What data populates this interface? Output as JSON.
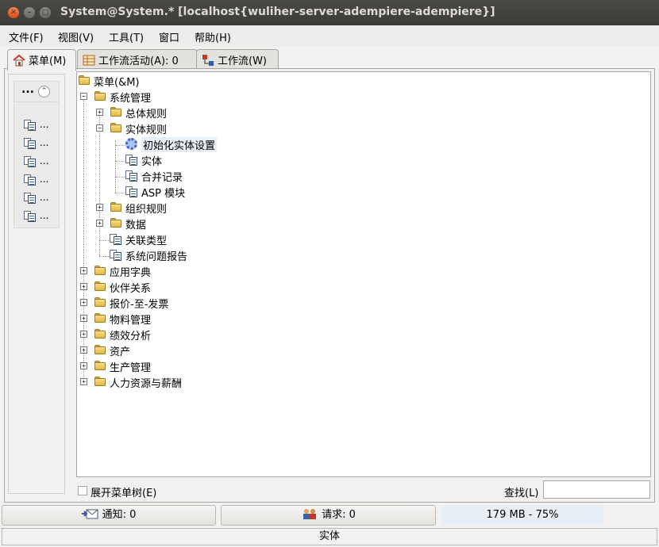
{
  "window": {
    "title": "System@System.* [localhost{wuliher-server-adempiere-adempiere}]",
    "close_glyph": "✕",
    "min_glyph": "–",
    "max_glyph": "□"
  },
  "menubar": {
    "items": [
      "文件(F)",
      "视图(V)",
      "工具(T)",
      "窗口",
      "帮助(H)"
    ]
  },
  "tabs": [
    {
      "label": "菜单(M)",
      "icon": "home-icon"
    },
    {
      "label": "工作流活动(A): 0",
      "icon": "table-icon"
    },
    {
      "label": "工作流(W)",
      "icon": "workflow-icon"
    }
  ],
  "left_panel": {
    "header": "...",
    "collapse_glyph": "⌃",
    "entries": [
      "...",
      "...",
      "...",
      "...",
      "...",
      "..."
    ]
  },
  "tree": {
    "root": "菜单(&M)",
    "system_admin": "系统管理",
    "general_rules": "总体规则",
    "entity_rules": "实体规则",
    "init_entity_setup": "初始化实体设置",
    "entity": "实体",
    "merge_records": "合并记录",
    "asp_module": "ASP 模块",
    "org_rules": "组织规则",
    "data": "数据",
    "relation_type": "关联类型",
    "system_issue_report": "系统问题报告",
    "application_dictionary": "应用字典",
    "partner_relations": "伙伴关系",
    "quote_to_invoice": "报价-至-发票",
    "material_management": "物料管理",
    "performance_analysis": "绩效分析",
    "assets": "资产",
    "manufacturing": "生产管理",
    "hr_payroll": "人力资源与薪酬",
    "plus": "+",
    "minus": "−"
  },
  "bottom": {
    "expand_tree_label": "展开菜单树(E)",
    "find_label": "查找(L)",
    "find_value": ""
  },
  "status": {
    "notices": "通知: 0",
    "requests": "请求: 0",
    "memory": "179 MB - 75%",
    "current": "实体"
  }
}
